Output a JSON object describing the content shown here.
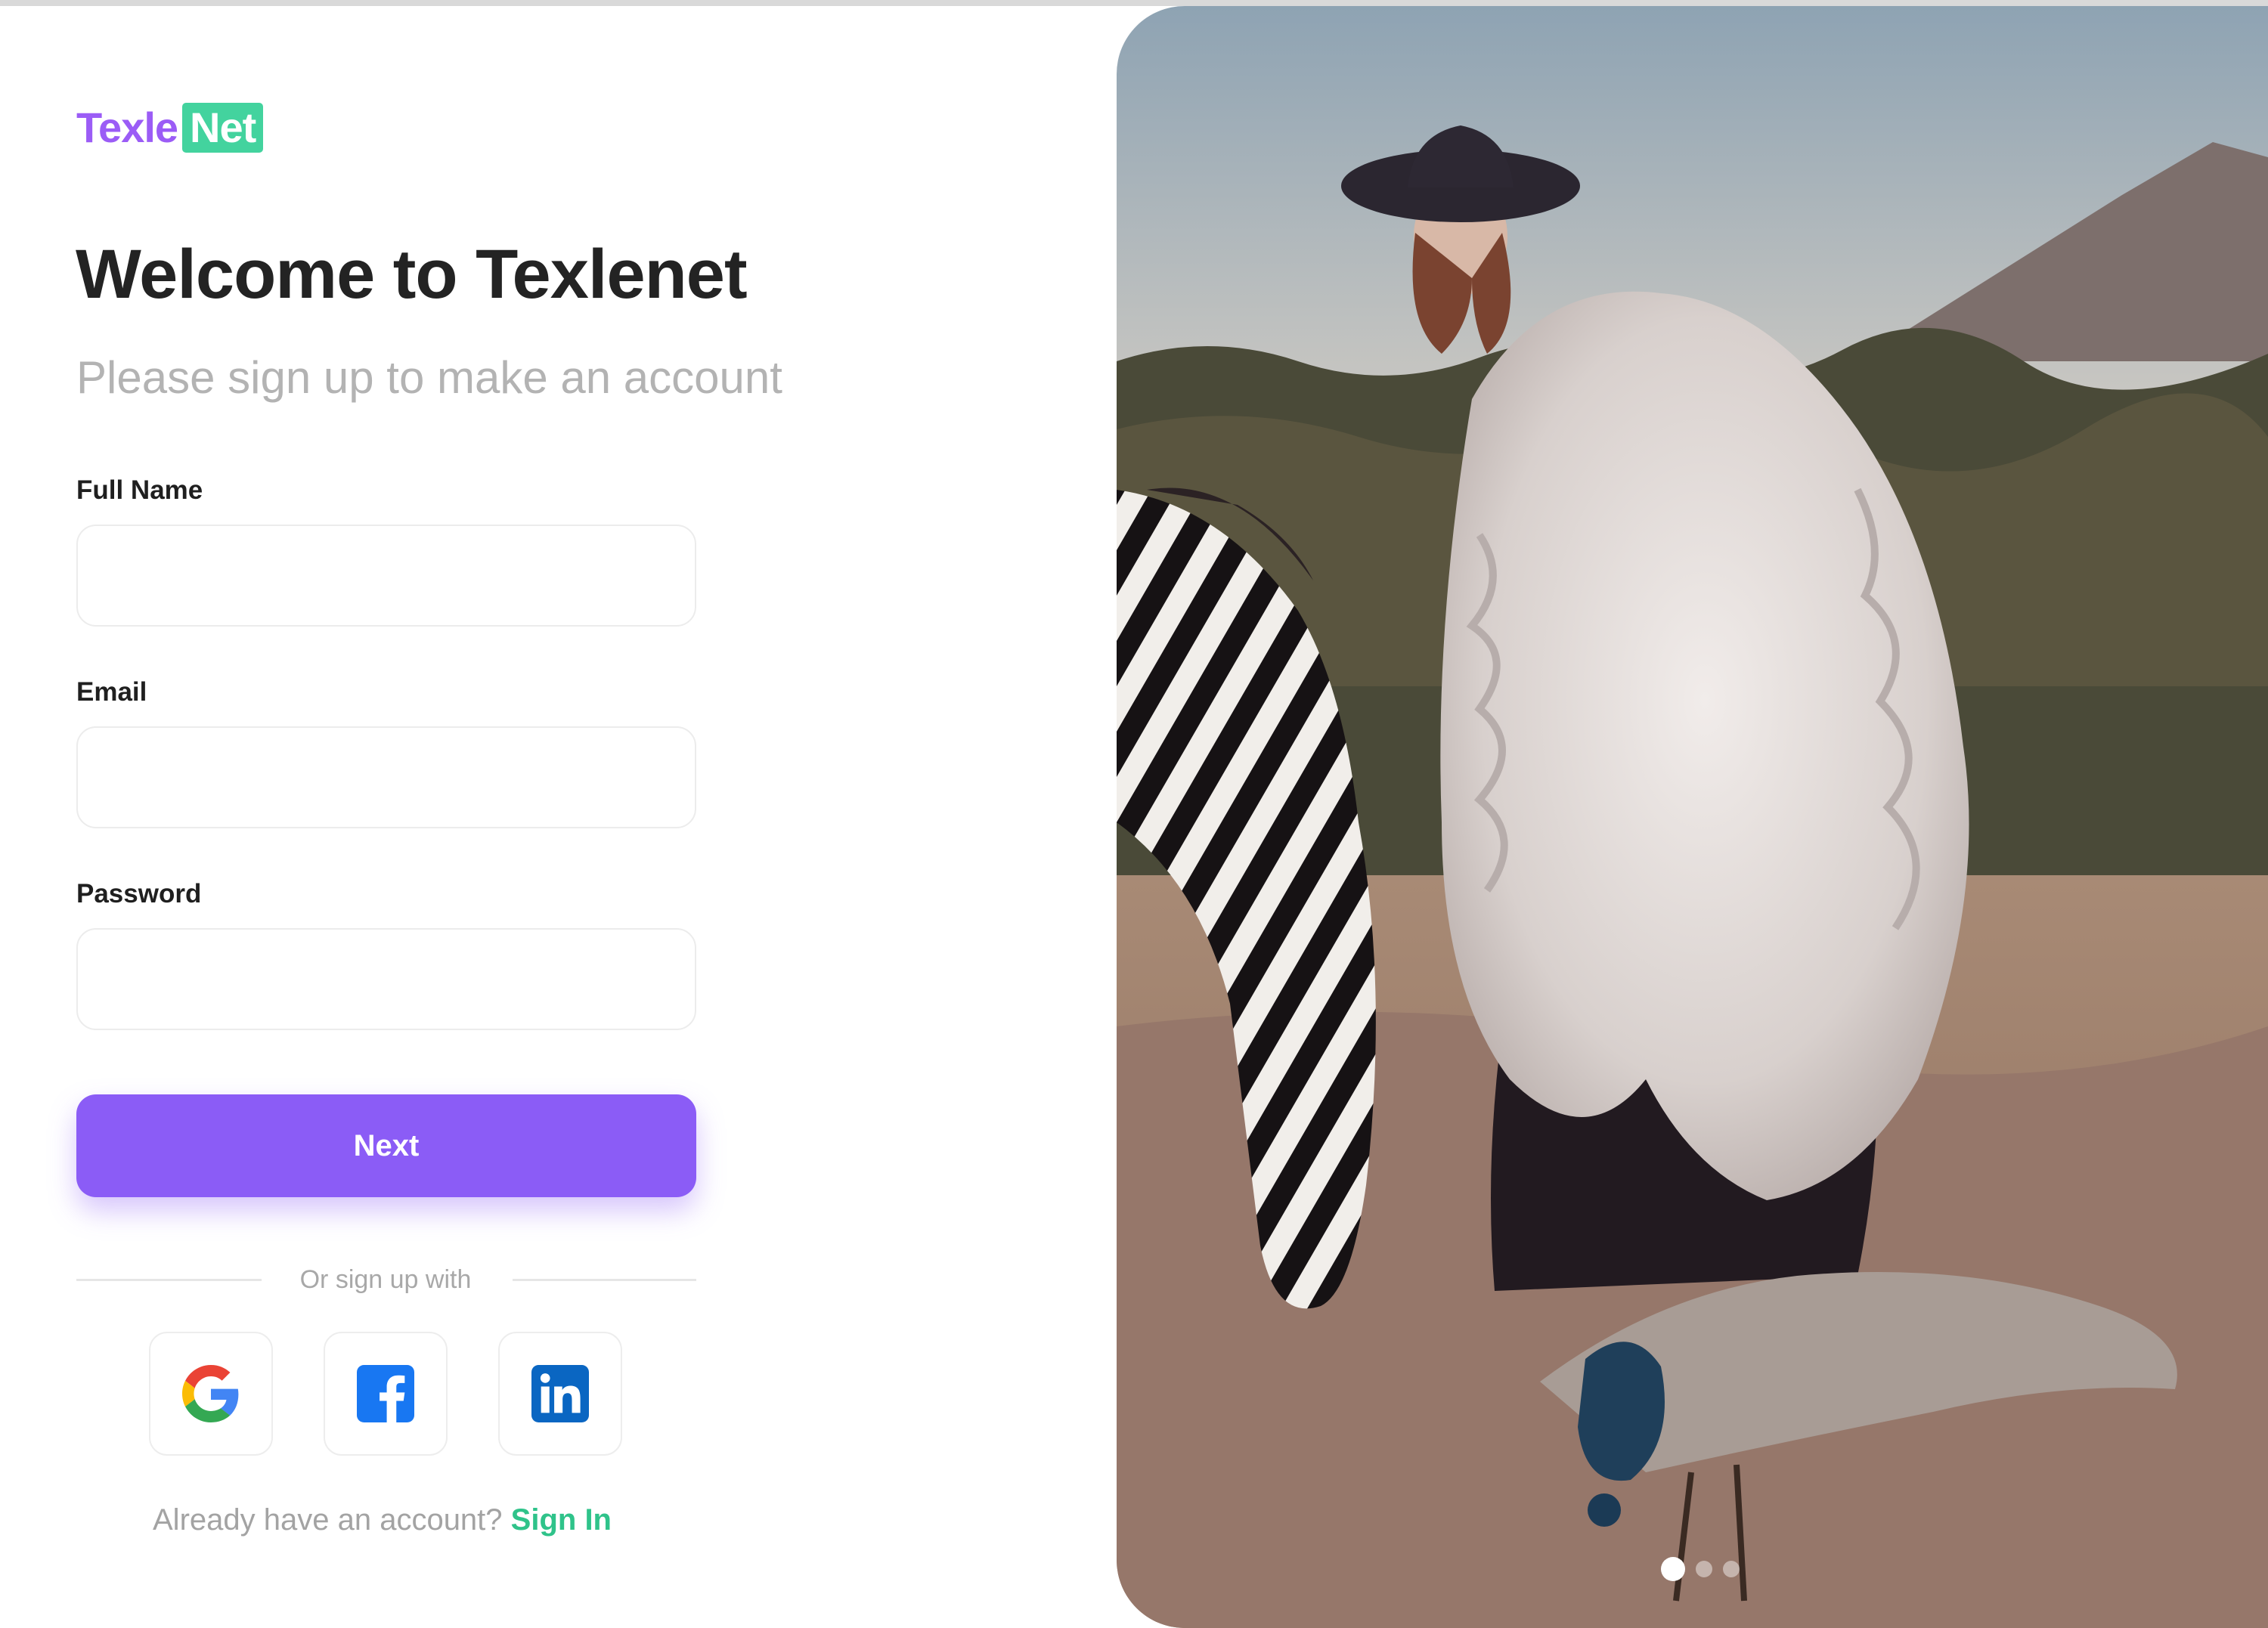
{
  "logo": {
    "part1": "Texle",
    "part2": "Net"
  },
  "heading": {
    "title": "Welcome to Texlenet",
    "subtitle": "Please sign up to make an account"
  },
  "form": {
    "full_name_label": "Full Name",
    "full_name_value": "",
    "full_name_placeholder": "",
    "email_label": "Email",
    "email_value": "",
    "email_placeholder": "",
    "password_label": "Password",
    "password_value": "",
    "password_placeholder": "",
    "next_label": "Next"
  },
  "social": {
    "divider_text": "Or sign up with",
    "providers": [
      {
        "icon": "google-icon"
      },
      {
        "icon": "facebook-icon"
      },
      {
        "icon": "linkedin-icon"
      }
    ]
  },
  "footer": {
    "prompt": "Already have an account?",
    "link": "Sign In"
  },
  "carousel": {
    "slides": 3,
    "active": 1
  },
  "colors": {
    "primary": "#8b5cf6",
    "accent": "#43d39e",
    "link": "#2fc38a",
    "muted": "#b3b3b3"
  }
}
